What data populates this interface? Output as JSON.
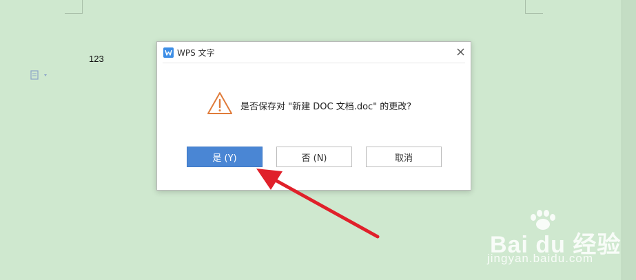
{
  "document": {
    "body_text": "123"
  },
  "dialog": {
    "title": "WPS 文字",
    "message": "是否保存对 \"新建 DOC 文档.doc\" 的更改?",
    "buttons": {
      "yes": "是 (Y)",
      "no": "否 (N)",
      "cancel": "取消"
    },
    "icons": {
      "app": "wps-writer-icon",
      "warning": "warning-triangle-icon",
      "close": "close-icon"
    }
  },
  "watermark": {
    "brand": "Bai du 经验",
    "url": "jingyan.baidu.com"
  },
  "colors": {
    "background": "#cfe8cf",
    "primary_button": "#4a86d4",
    "warning": "#e07b3a",
    "annotation_arrow": "#e0202a"
  }
}
